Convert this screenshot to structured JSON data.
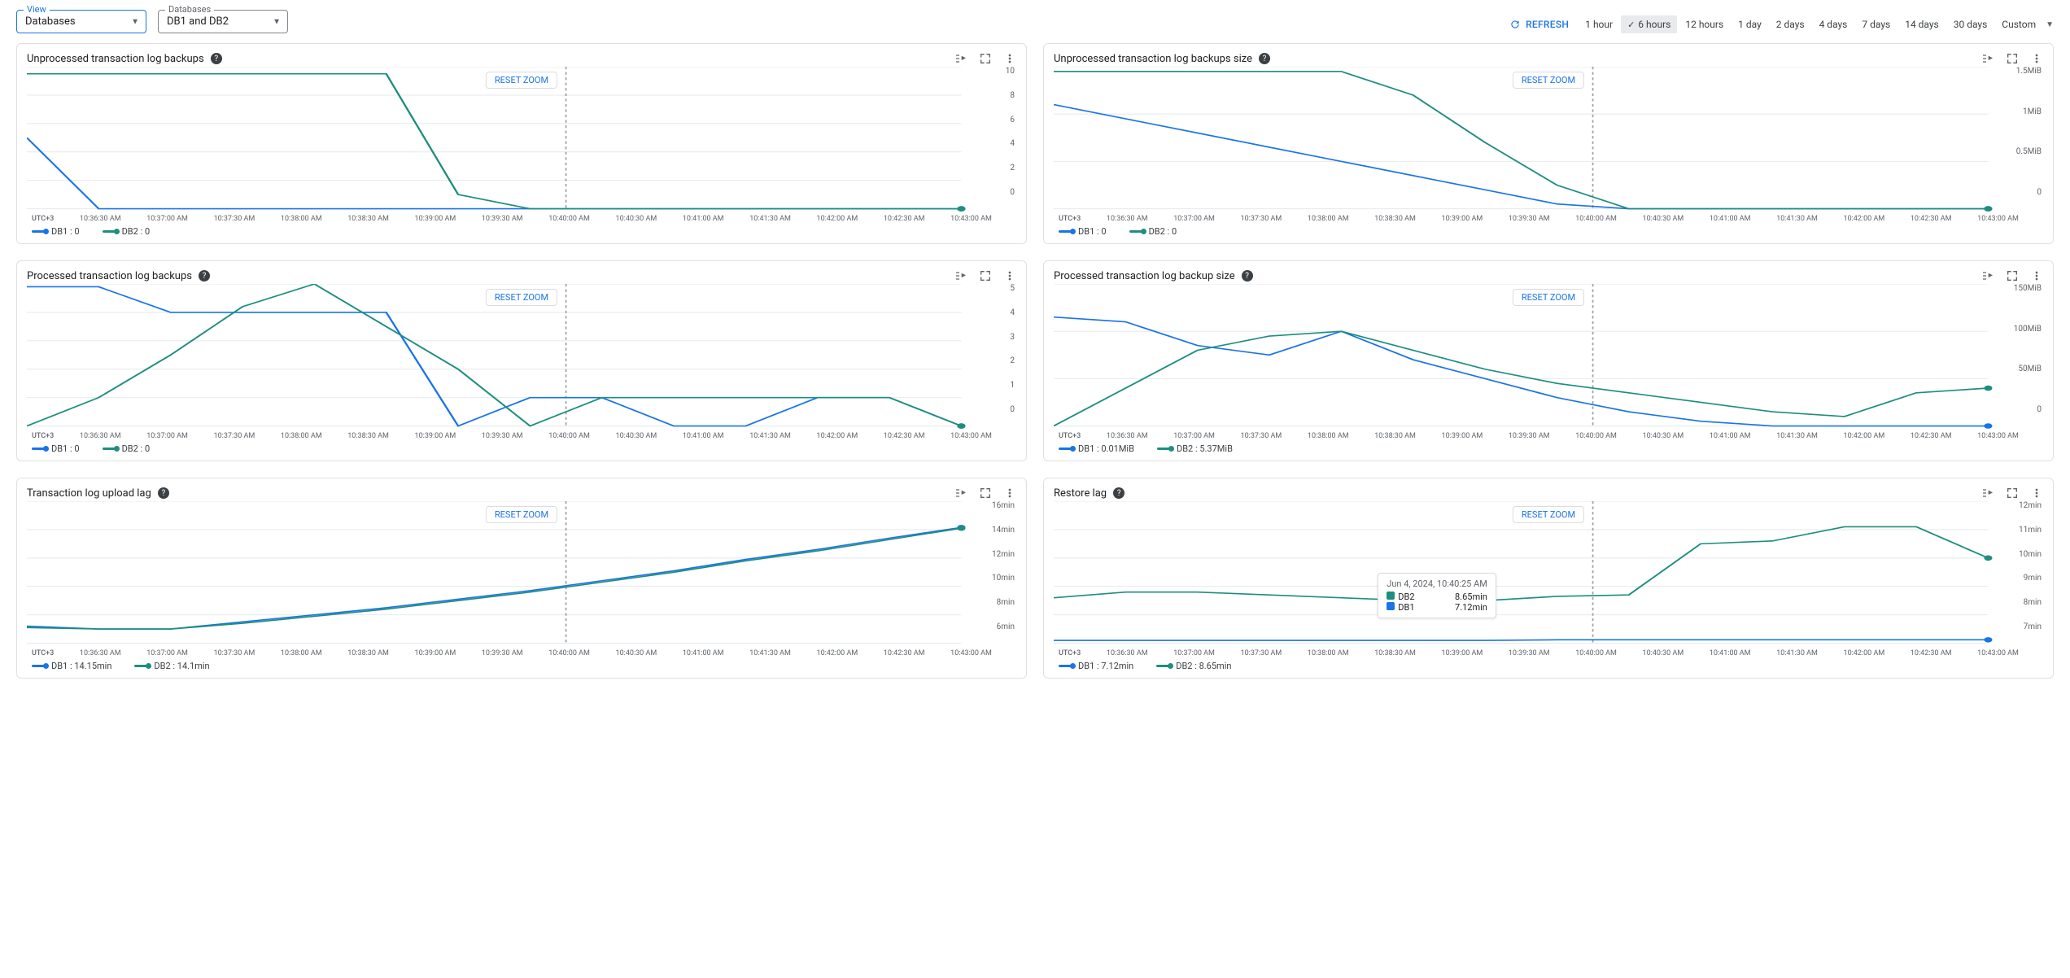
{
  "filters": {
    "view_label": "View",
    "view_value": "Databases",
    "db_label": "Databases",
    "db_value": "DB1 and DB2"
  },
  "toolbar": {
    "refresh": "REFRESH",
    "ranges": [
      "1 hour",
      "6 hours",
      "12 hours",
      "1 day",
      "2 days",
      "4 days",
      "7 days",
      "14 days",
      "30 days",
      "Custom"
    ],
    "active_range": "6 hours"
  },
  "axis": {
    "tz": "UTC+3",
    "times": [
      "10:36:30 AM",
      "10:37:00 AM",
      "10:37:30 AM",
      "10:38:00 AM",
      "10:38:30 AM",
      "10:39:00 AM",
      "10:39:30 AM",
      "10:40:00 AM",
      "10:40:30 AM",
      "10:41:00 AM",
      "10:41:30 AM",
      "10:42:00 AM",
      "10:42:30 AM",
      "10:43:00 AM"
    ]
  },
  "colors": {
    "db1": "#1a73e8",
    "db2": "#1e8e7e"
  },
  "charts": [
    {
      "id": "unprocessed-count",
      "title": "Unprocessed transaction log backups",
      "reset": "RESET ZOOM",
      "ylabels": [
        "10",
        "8",
        "6",
        "4",
        "2",
        "0"
      ],
      "legend": [
        {
          "name": "DB1",
          "value": "0"
        },
        {
          "name": "DB2",
          "value": "0"
        }
      ]
    },
    {
      "id": "unprocessed-size",
      "title": "Unprocessed transaction log backups size",
      "reset": "RESET ZOOM",
      "ylabels": [
        "1.5MiB",
        "1MiB",
        "0.5MiB",
        "0"
      ],
      "legend": [
        {
          "name": "DB1",
          "value": "0"
        },
        {
          "name": "DB2",
          "value": "0"
        }
      ]
    },
    {
      "id": "processed-count",
      "title": "Processed transaction log backups",
      "reset": "RESET ZOOM",
      "ylabels": [
        "5",
        "4",
        "3",
        "2",
        "1",
        "0"
      ],
      "legend": [
        {
          "name": "DB1",
          "value": "0"
        },
        {
          "name": "DB2",
          "value": "0"
        }
      ]
    },
    {
      "id": "processed-size",
      "title": "Processed transaction log backup size",
      "reset": "RESET ZOOM",
      "ylabels": [
        "150MiB",
        "100MiB",
        "50MiB",
        "0"
      ],
      "legend": [
        {
          "name": "DB1",
          "value": "0.01MiB"
        },
        {
          "name": "DB2",
          "value": "5.37MiB"
        }
      ]
    },
    {
      "id": "upload-lag",
      "title": "Transaction log upload lag",
      "reset": "RESET ZOOM",
      "ylabels": [
        "16min",
        "14min",
        "12min",
        "10min",
        "8min",
        "6min"
      ],
      "legend": [
        {
          "name": "DB1",
          "value": "14.15min"
        },
        {
          "name": "DB2",
          "value": "14.1min"
        }
      ]
    },
    {
      "id": "restore-lag",
      "title": "Restore lag",
      "reset": "RESET ZOOM",
      "ylabels": [
        "12min",
        "11min",
        "10min",
        "9min",
        "8min",
        "7min"
      ],
      "legend": [
        {
          "name": "DB1",
          "value": "7.12min"
        },
        {
          "name": "DB2",
          "value": "8.65min"
        }
      ],
      "tooltip": {
        "ts": "Jun 4, 2024, 10:40:25 AM",
        "rows": [
          {
            "name": "DB2",
            "value": "8.65min"
          },
          {
            "name": "DB1",
            "value": "7.12min"
          }
        ]
      }
    }
  ],
  "chart_data": [
    {
      "id": "unprocessed-count",
      "type": "line",
      "x": [
        "10:36:30",
        "10:37:00",
        "10:37:30",
        "10:38:00",
        "10:38:30",
        "10:39:00",
        "10:39:30",
        "10:40:00",
        "10:40:30",
        "10:41:00",
        "10:41:30",
        "10:42:00",
        "10:42:30",
        "10:43:00"
      ],
      "series": [
        {
          "name": "DB1",
          "values": [
            5,
            0,
            0,
            0,
            0,
            0,
            0,
            0,
            0,
            0,
            0,
            0,
            0,
            0
          ]
        },
        {
          "name": "DB2",
          "values": [
            9.5,
            9.5,
            9.5,
            9.5,
            9.5,
            9.5,
            1,
            0,
            0,
            0,
            0,
            0,
            0,
            0
          ]
        }
      ],
      "ylim": [
        0,
        10
      ],
      "ylabel": "",
      "xlabel": "",
      "title": "Unprocessed transaction log backups"
    },
    {
      "id": "unprocessed-size",
      "type": "line",
      "x": [
        "10:36:30",
        "10:37:00",
        "10:37:30",
        "10:38:00",
        "10:38:30",
        "10:39:00",
        "10:39:30",
        "10:40:00",
        "10:40:30",
        "10:41:00",
        "10:41:30",
        "10:42:00",
        "10:42:30",
        "10:43:00"
      ],
      "series": [
        {
          "name": "DB1",
          "values": [
            1.1,
            0.95,
            0.8,
            0.65,
            0.5,
            0.35,
            0.2,
            0.05,
            0,
            0,
            0,
            0,
            0,
            0
          ]
        },
        {
          "name": "DB2",
          "values": [
            1.45,
            1.45,
            1.45,
            1.45,
            1.45,
            1.2,
            0.7,
            0.25,
            0,
            0,
            0,
            0,
            0,
            0
          ]
        }
      ],
      "ylim": [
        0,
        1.5
      ],
      "ylabel": "MiB",
      "title": "Unprocessed transaction log backups size"
    },
    {
      "id": "processed-count",
      "type": "line",
      "x": [
        "10:36:30",
        "10:37:00",
        "10:37:30",
        "10:38:00",
        "10:38:30",
        "10:39:00",
        "10:39:30",
        "10:40:00",
        "10:40:30",
        "10:41:00",
        "10:41:30",
        "10:42:00",
        "10:42:30",
        "10:43:00"
      ],
      "series": [
        {
          "name": "DB1",
          "values": [
            4.9,
            4.9,
            4,
            4,
            4,
            4,
            0,
            1,
            1,
            0,
            0,
            1,
            1,
            0
          ]
        },
        {
          "name": "DB2",
          "values": [
            0,
            1,
            2.5,
            4.2,
            5,
            3.5,
            2,
            0,
            1,
            1,
            1,
            1,
            1,
            0
          ]
        }
      ],
      "ylim": [
        0,
        5
      ],
      "title": "Processed transaction log backups"
    },
    {
      "id": "processed-size",
      "type": "line",
      "x": [
        "10:36:30",
        "10:37:00",
        "10:37:30",
        "10:38:00",
        "10:38:30",
        "10:39:00",
        "10:39:30",
        "10:40:00",
        "10:40:30",
        "10:41:00",
        "10:41:30",
        "10:42:00",
        "10:42:30",
        "10:43:00"
      ],
      "series": [
        {
          "name": "DB1",
          "values": [
            115,
            110,
            85,
            75,
            100,
            70,
            50,
            30,
            15,
            5,
            0.01,
            0.01,
            0.01,
            0.01
          ]
        },
        {
          "name": "DB2",
          "values": [
            0,
            40,
            80,
            95,
            100,
            80,
            60,
            45,
            35,
            25,
            15,
            10,
            35,
            40
          ]
        }
      ],
      "ylim": [
        0,
        150
      ],
      "ylabel": "MiB",
      "title": "Processed transaction log backup size"
    },
    {
      "id": "upload-lag",
      "type": "line",
      "x": [
        "10:36:30",
        "10:37:00",
        "10:37:30",
        "10:38:00",
        "10:38:30",
        "10:39:00",
        "10:39:30",
        "10:40:00",
        "10:40:30",
        "10:41:00",
        "10:41:30",
        "10:42:00",
        "10:42:30",
        "10:43:00"
      ],
      "series": [
        {
          "name": "DB1",
          "values": [
            7.2,
            7.0,
            7.0,
            7.5,
            8.0,
            8.5,
            9.1,
            9.7,
            10.4,
            11.1,
            11.9,
            12.6,
            13.4,
            14.15
          ]
        },
        {
          "name": "DB2",
          "values": [
            7.1,
            7.0,
            7.0,
            7.4,
            7.9,
            8.4,
            9.0,
            9.6,
            10.3,
            11.0,
            11.8,
            12.5,
            13.3,
            14.1
          ]
        }
      ],
      "ylim": [
        6,
        16
      ],
      "ylabel": "min",
      "title": "Transaction log upload lag"
    },
    {
      "id": "restore-lag",
      "type": "line",
      "x": [
        "10:36:30",
        "10:37:00",
        "10:37:30",
        "10:38:00",
        "10:38:30",
        "10:39:00",
        "10:39:30",
        "10:40:00",
        "10:40:30",
        "10:41:00",
        "10:41:30",
        "10:42:00",
        "10:42:30",
        "10:43:00"
      ],
      "series": [
        {
          "name": "DB1",
          "values": [
            7.1,
            7.1,
            7.1,
            7.1,
            7.1,
            7.1,
            7.1,
            7.12,
            7.12,
            7.12,
            7.12,
            7.12,
            7.12,
            7.12
          ]
        },
        {
          "name": "DB2",
          "values": [
            8.6,
            8.8,
            8.8,
            8.7,
            8.6,
            8.5,
            8.5,
            8.65,
            8.7,
            10.5,
            10.6,
            11.1,
            11.1,
            10.0
          ]
        }
      ],
      "ylim": [
        7,
        12
      ],
      "ylabel": "min",
      "title": "Restore lag"
    }
  ]
}
